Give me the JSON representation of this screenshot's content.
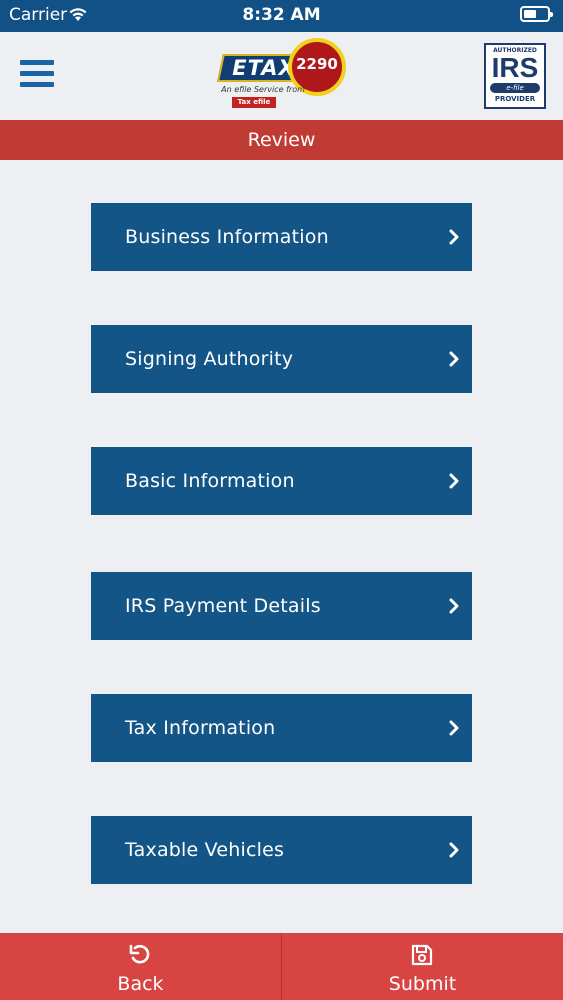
{
  "status_bar": {
    "carrier": "Carrier",
    "time": "8:32 AM"
  },
  "header": {
    "logo": {
      "brand": "ETAX",
      "number": "2290",
      "tagline": "An efile Service from",
      "sub_brand": "Tax efile"
    },
    "irs_badge": {
      "top": "AUTHORIZED",
      "main": "IRS",
      "middle": "e-file",
      "bottom": "PROVIDER"
    }
  },
  "page": {
    "title": "Review"
  },
  "menu": [
    {
      "label": "Business Information"
    },
    {
      "label": "Signing Authority"
    },
    {
      "label": "Basic Information"
    },
    {
      "label": "IRS Payment Details"
    },
    {
      "label": "Tax Information"
    },
    {
      "label": "Taxable Vehicles"
    }
  ],
  "footer": {
    "back_label": "Back",
    "submit_label": "Submit"
  },
  "colors": {
    "primary": "#125186",
    "accent_red": "#c13b35",
    "button_blue": "#135586",
    "footer_red": "#d84442"
  }
}
